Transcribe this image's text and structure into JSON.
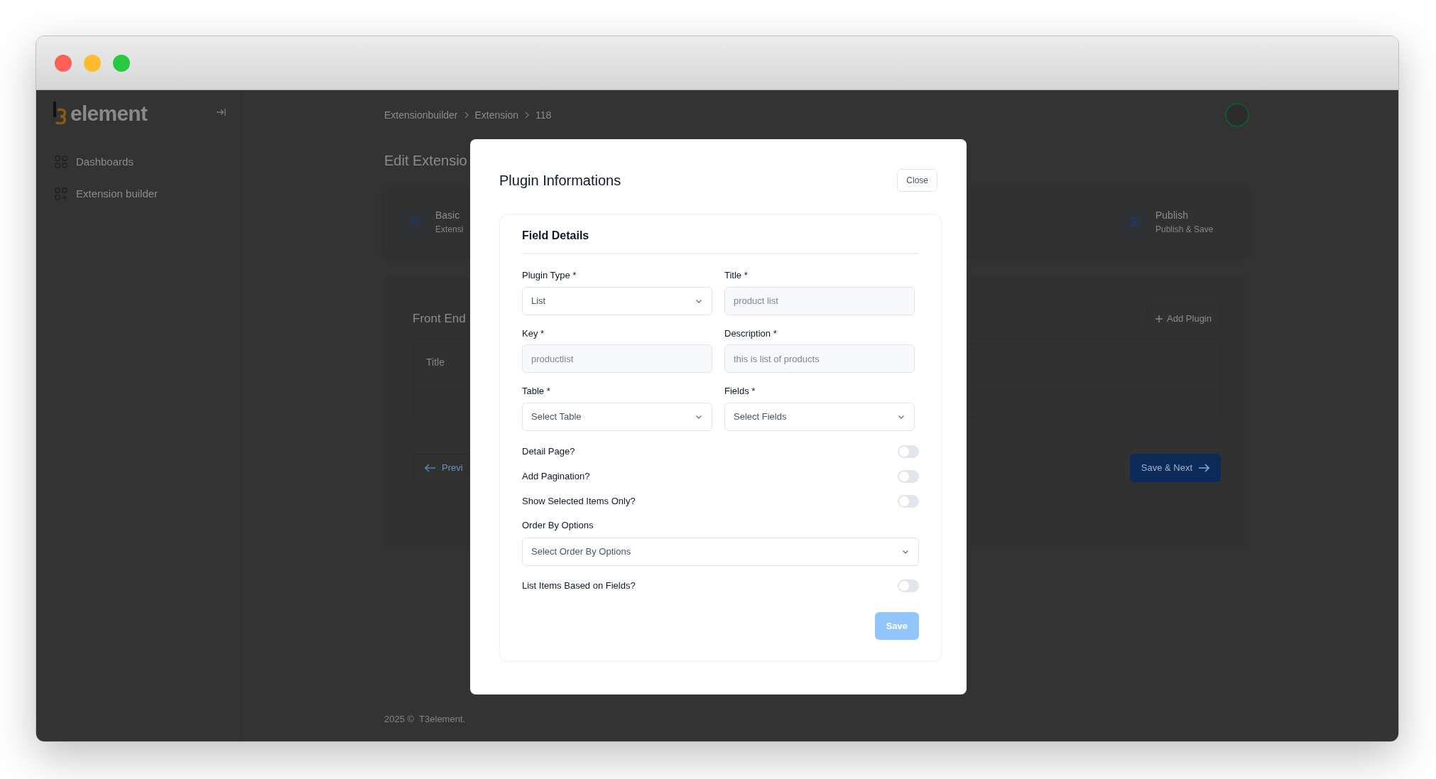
{
  "sidebar": {
    "logo": "element",
    "items": [
      {
        "label": "Dashboards",
        "kind": "grid"
      },
      {
        "label": "Extension builder",
        "kind": "grid-plus"
      }
    ]
  },
  "breadcrumb": [
    "Extensionbuilder",
    "Extension",
    "118"
  ],
  "page_title": "Edit Extensio",
  "steps": [
    {
      "title": "Basic",
      "subtitle": "Extensi",
      "kind": "settings"
    },
    {
      "title": "Publish",
      "subtitle": "Publish & Save",
      "kind": "sliders"
    }
  ],
  "section_title": "Front End",
  "add_button": "Add Plugin",
  "table": {
    "columns": [
      "Title"
    ]
  },
  "nav": {
    "previous": "Previ",
    "next": "Save & Next"
  },
  "footer": "2025 ©  T3element.",
  "modal": {
    "title": "Plugin Informations",
    "close": "Close",
    "card_title": "Field Details",
    "fields": [
      {
        "label": "Plugin Type *",
        "kind": "select",
        "value": "List"
      },
      {
        "label": "Title *",
        "kind": "input",
        "placeholder": "product list"
      },
      {
        "label": "Key *",
        "kind": "input",
        "placeholder": "productlist"
      },
      {
        "label": "Description *",
        "kind": "input",
        "placeholder": "this is list of products"
      },
      {
        "label": "Table *",
        "kind": "select",
        "placeholder": "Select Table"
      },
      {
        "label": "Fields *",
        "kind": "select",
        "placeholder": "Select Fields"
      }
    ],
    "rows": [
      {
        "kind": "toggle",
        "label": "Detail Page?",
        "on": false
      },
      {
        "kind": "toggle",
        "label": "Add Pagination?",
        "on": false
      },
      {
        "kind": "toggle",
        "label": "Show Selected Items Only?",
        "on": false
      },
      {
        "kind": "select",
        "label": "Order By Options",
        "placeholder": "Select Order By Options"
      },
      {
        "kind": "toggle",
        "label": "List Items Based on Fields?",
        "on": false
      }
    ],
    "save": {
      "label": "Save",
      "disabled": true
    }
  }
}
